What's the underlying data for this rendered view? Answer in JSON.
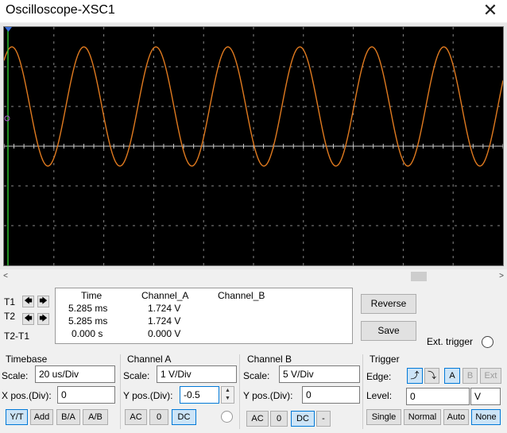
{
  "window": {
    "title": "Oscilloscope-XSC1",
    "close_glyph": "✕"
  },
  "scope": {
    "bg": "#000000",
    "grid_color": "#888888",
    "trace_color": "#e07a1f",
    "cursor_color": "#2fbf2f",
    "cursor_t2_color": "#3a6ed8"
  },
  "scrollbar": {
    "left_arrow": "<",
    "right_arrow": ">"
  },
  "cursors": {
    "t1_label": "T1",
    "t2_label": "T2",
    "t2t1_label": "T2-T1",
    "left_glyph": "🡄",
    "right_glyph": "🡆"
  },
  "readout": {
    "headers": [
      "Time",
      "Channel_A",
      "Channel_B"
    ],
    "rows": [
      {
        "time": "5.285 ms",
        "a": "1.724 V",
        "b": ""
      },
      {
        "time": "5.285 ms",
        "a": "1.724 V",
        "b": ""
      },
      {
        "time": "0.000 s",
        "a": "0.000 V",
        "b": ""
      }
    ]
  },
  "actions": {
    "reverse": "Reverse",
    "save": "Save",
    "ext_trigger": "Ext. trigger"
  },
  "timebase": {
    "title": "Timebase",
    "scale_label": "Scale:",
    "scale_value": "20 us/Div",
    "xpos_label": "X pos.(Div):",
    "xpos_value": "0",
    "modes": [
      "Y/T",
      "Add",
      "B/A",
      "A/B"
    ],
    "selected_mode": "Y/T"
  },
  "channel_a": {
    "title": "Channel A",
    "scale_label": "Scale:",
    "scale_value": "1  V/Div",
    "ypos_label": "Y pos.(Div):",
    "ypos_value": "-0.5",
    "coupling": [
      "AC",
      "0",
      "DC"
    ],
    "selected_coupling": "DC",
    "spin_up": "▲",
    "spin_down": "▼"
  },
  "channel_b": {
    "title": "Channel B",
    "scale_label": "Scale:",
    "scale_value": "5  V/Div",
    "ypos_label": "Y pos.(Div):",
    "ypos_value": "0",
    "coupling": [
      "AC",
      "0",
      "DC",
      "-"
    ],
    "selected_coupling": "DC"
  },
  "trigger": {
    "title": "Trigger",
    "edge_label": "Edge:",
    "rising_glyph": "⤴",
    "falling_glyph": "⤵",
    "sources": [
      "A",
      "B",
      "Ext"
    ],
    "selected_source": "A",
    "level_label": "Level:",
    "level_value": "0",
    "level_unit": "V",
    "modes": [
      "Single",
      "Normal",
      "Auto",
      "None"
    ],
    "selected_mode": "None"
  }
}
